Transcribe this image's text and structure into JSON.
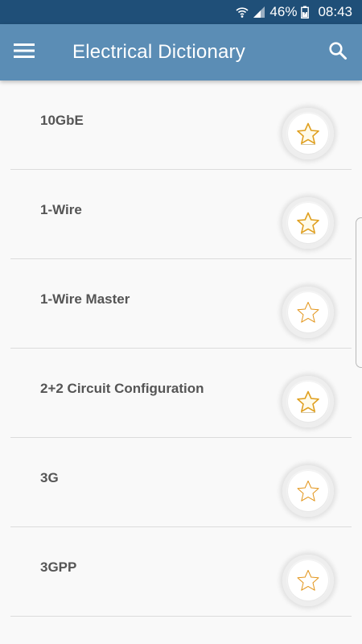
{
  "status_bar": {
    "battery": "46%",
    "time": "08:43",
    "icons": [
      "wifi-icon",
      "signal-icon",
      "battery-icon"
    ]
  },
  "app_bar": {
    "title": "Electrical Dictionary",
    "menu_icon": "hamburger-menu-icon",
    "search_icon": "search-icon"
  },
  "terms": [
    {
      "label": "10GbE",
      "favorite": false
    },
    {
      "label": "1-Wire",
      "favorite": false
    },
    {
      "label": "1-Wire Master",
      "favorite": true
    },
    {
      "label": "2+2 Circuit Configuration",
      "favorite": false
    },
    {
      "label": "3G",
      "favorite": true
    },
    {
      "label": "3GPP",
      "favorite": true
    }
  ],
  "colors": {
    "status_bar": "#1f4f78",
    "app_bar": "#5b8db5",
    "star_gold": "#f2a51a",
    "star_outline": "#e0a020",
    "label_text": "#555555"
  }
}
